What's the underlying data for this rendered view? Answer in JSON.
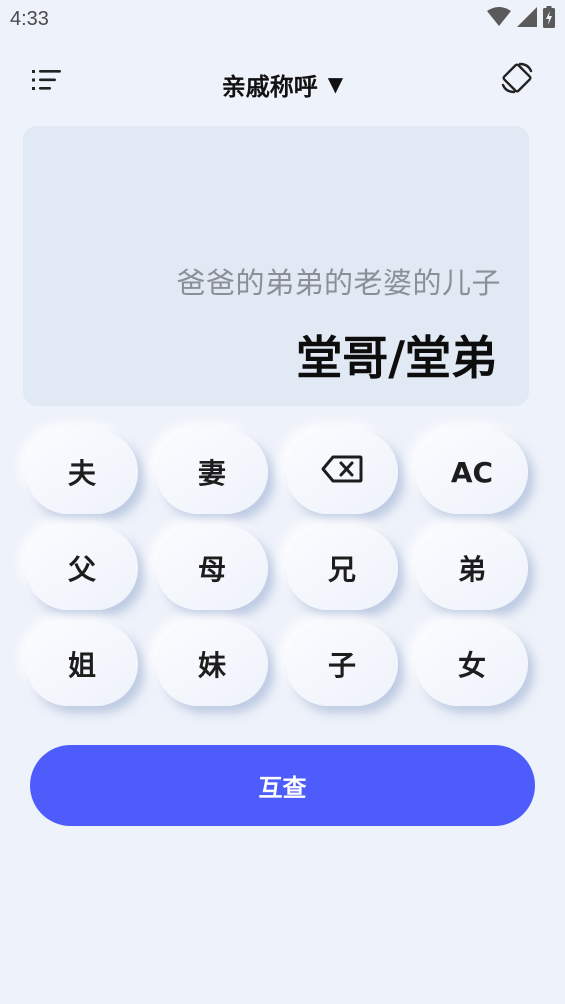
{
  "status_bar": {
    "time": "4:33",
    "icons": [
      "wifi-icon",
      "cell-signal-icon",
      "battery-icon"
    ]
  },
  "toolbar": {
    "menu_icon": "menu-list-icon",
    "title": "亲戚称呼",
    "title_arrow": "▼",
    "rotate_icon": "screen-rotate-icon"
  },
  "display": {
    "expression": "爸爸的弟弟的老婆的儿子",
    "result": "堂哥/堂弟"
  },
  "keypad": {
    "keys": [
      {
        "label": "夫"
      },
      {
        "label": "妻"
      },
      {
        "label": "",
        "icon": "backspace-icon"
      },
      {
        "label": "AC"
      },
      {
        "label": "父"
      },
      {
        "label": "母"
      },
      {
        "label": "兄"
      },
      {
        "label": "弟"
      },
      {
        "label": "姐"
      },
      {
        "label": "妹"
      },
      {
        "label": "子"
      },
      {
        "label": "女"
      }
    ]
  },
  "actions": {
    "query_label": "互查"
  },
  "colors": {
    "background": "#eef2fa",
    "display_panel": "#e1e9f4",
    "accent": "#4d5cfb"
  }
}
